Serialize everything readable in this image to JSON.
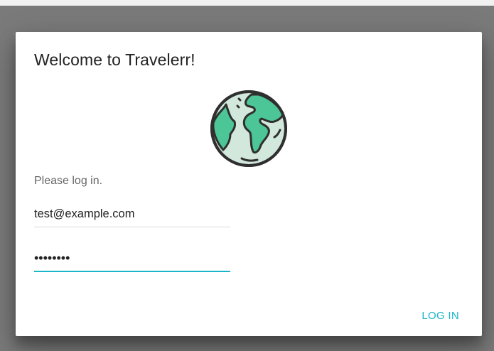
{
  "dialog": {
    "title": "Welcome to Travelerr!",
    "prompt": "Please log in."
  },
  "form": {
    "email": {
      "value": "test@example.com"
    },
    "password": {
      "value": "••••••••"
    },
    "login_label": "LOG IN"
  },
  "colors": {
    "accent": "#19b5c8",
    "globe_land": "#4cc597",
    "globe_ocean": "#d3e8dd",
    "globe_outline": "#2f2f2f"
  },
  "icons": {
    "logo": "globe-icon"
  }
}
